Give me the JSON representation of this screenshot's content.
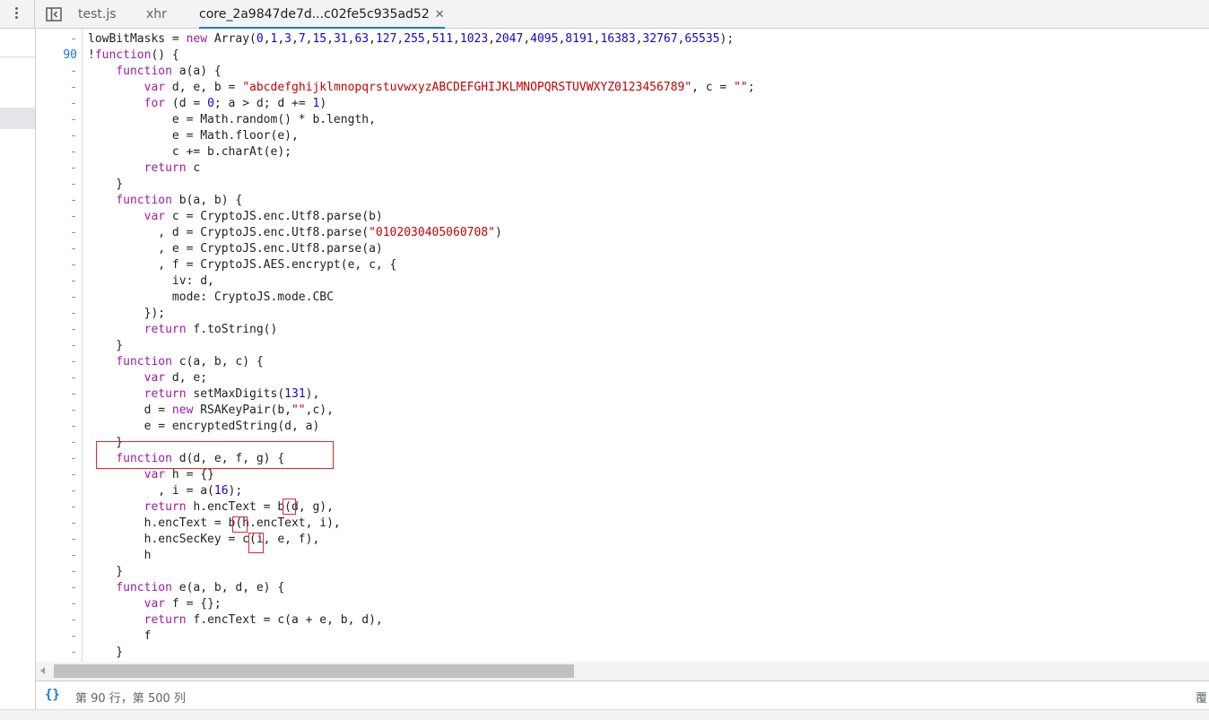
{
  "tabs": [
    {
      "label": "test.js"
    },
    {
      "label": "xhr"
    },
    {
      "label": "core_2a9847de7d...c02fe5c935ad52",
      "close": "✕"
    }
  ],
  "editor": {
    "lines": [
      {
        "n": "-",
        "html": "lowBitMasks = <span class=\"kw\">new</span> Array(<span class=\"nm\">0</span>,<span class=\"nm\">1</span>,<span class=\"nm\">3</span>,<span class=\"nm\">7</span>,<span class=\"nm\">15</span>,<span class=\"nm\">31</span>,<span class=\"nm\">63</span>,<span class=\"nm\">127</span>,<span class=\"nm\">255</span>,<span class=\"nm\">511</span>,<span class=\"nm\">1023</span>,<span class=\"nm\">2047</span>,<span class=\"nm\">4095</span>,<span class=\"nm\">8191</span>,<span class=\"nm\">16383</span>,<span class=\"nm\">32767</span>,<span class=\"nm\">65535</span>);"
      },
      {
        "n": "90",
        "html": "!<span class=\"kw\">function</span>() {"
      },
      {
        "n": "-",
        "html": "    <span class=\"kw\">function</span> a(a) {"
      },
      {
        "n": "-",
        "html": "        <span class=\"kw\">var</span> d, e, b = <span class=\"st\">\"abcdefghijklmnopqrstuvwxyzABCDEFGHIJKLMNOPQRSTUVWXYZ0123456789\"</span>, c = <span class=\"st\">\"\"</span>;"
      },
      {
        "n": "-",
        "html": "        <span class=\"kw\">for</span> (d = <span class=\"nm\">0</span>; a > d; d += <span class=\"nm\">1</span>)"
      },
      {
        "n": "-",
        "html": "            e = Math.random() * b.length,"
      },
      {
        "n": "-",
        "html": "            e = Math.floor(e),"
      },
      {
        "n": "-",
        "html": "            c += b.charAt(e);"
      },
      {
        "n": "-",
        "html": "        <span class=\"kw\">return</span> c"
      },
      {
        "n": "-",
        "html": "    }"
      },
      {
        "n": "-",
        "html": "    <span class=\"kw\">function</span> b(a, b) {"
      },
      {
        "n": "-",
        "html": "        <span class=\"kw\">var</span> c = CryptoJS.enc.Utf8.parse(b)"
      },
      {
        "n": "-",
        "html": "          , d = CryptoJS.enc.Utf8.parse(<span class=\"st\">\"0102030405060708\"</span>)"
      },
      {
        "n": "-",
        "html": "          , e = CryptoJS.enc.Utf8.parse(a)"
      },
      {
        "n": "-",
        "html": "          , f = CryptoJS.AES.encrypt(e, c, {"
      },
      {
        "n": "-",
        "html": "            iv: d,"
      },
      {
        "n": "-",
        "html": "            mode: CryptoJS.mode.CBC"
      },
      {
        "n": "-",
        "html": "        });"
      },
      {
        "n": "-",
        "html": "        <span class=\"kw\">return</span> f.toString()"
      },
      {
        "n": "-",
        "html": "    }"
      },
      {
        "n": "-",
        "html": "    <span class=\"kw\">function</span> c(a, b, c) {"
      },
      {
        "n": "-",
        "html": "        <span class=\"kw\">var</span> d, e;"
      },
      {
        "n": "-",
        "html": "        <span class=\"kw\">return</span> setMaxDigits(<span class=\"nm\">131</span>),"
      },
      {
        "n": "-",
        "html": "        d = <span class=\"kw\">new</span> RSAKeyPair(b,<span class=\"st\">\"\"</span>,c),"
      },
      {
        "n": "-",
        "html": "        e = encryptedString(d, a)"
      },
      {
        "n": "-",
        "html": "    }"
      },
      {
        "n": "-",
        "html": "    <span class=\"kw\">function</span> d(d, e, f, g) {"
      },
      {
        "n": "-",
        "html": "        <span class=\"kw\">var</span> h = {}"
      },
      {
        "n": "-",
        "html": "          , i = a(<span class=\"nm\">16</span>);"
      },
      {
        "n": "-",
        "html": "        <span class=\"kw\">return</span> h.encText = b(d, g),"
      },
      {
        "n": "-",
        "html": "        h.encText = b(h.encText, i),"
      },
      {
        "n": "-",
        "html": "        h.encSecKey = c(i, e, f),"
      },
      {
        "n": "-",
        "html": "        h"
      },
      {
        "n": "-",
        "html": "    }"
      },
      {
        "n": "-",
        "html": "    <span class=\"kw\">function</span> e(a, b, d, e) {"
      },
      {
        "n": "-",
        "html": "        <span class=\"kw\">var</span> f = {};"
      },
      {
        "n": "-",
        "html": "        <span class=\"kw\">return</span> f.encText = c(a + e, b, d),"
      },
      {
        "n": "-",
        "html": "        f"
      },
      {
        "n": "-",
        "html": "    }"
      }
    ]
  },
  "statusbar": {
    "braces": "{}",
    "cursor": "第 90 行，第 500 列",
    "right": "覆"
  }
}
